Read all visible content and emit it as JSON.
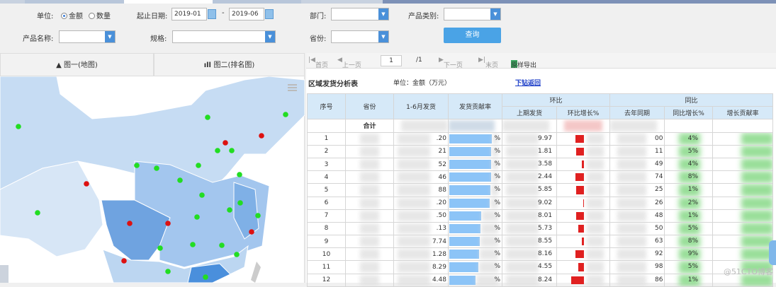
{
  "filters": {
    "unit_label": "单位:",
    "unit_options": [
      {
        "label": "金额",
        "selected": true
      },
      {
        "label": "数量",
        "selected": false
      }
    ],
    "date_label": "起止日期:",
    "date_start": "2019-01",
    "date_sep": "-",
    "date_end": "2019-06",
    "dept_label": "部门:",
    "category_label": "产品类别:",
    "product_label": "产品名称:",
    "spec_label": "规格:",
    "province_label": "省份:",
    "query_button": "查询"
  },
  "left_tabs": [
    {
      "label": "图一(地图)",
      "icon": "china-map-icon"
    },
    {
      "label": "图二(排名图)",
      "icon": "bar-chart-icon"
    }
  ],
  "map": {
    "colors": {
      "marker_up": "#22dd22",
      "marker_down": "#dd1111",
      "region": "#c6dcf3",
      "region_dark": "#6fa3e0"
    }
  },
  "pager": {
    "first": "首页",
    "prev": "上一页",
    "page": "1",
    "total": "/1",
    "next": "下一页",
    "last": "末页",
    "export": "原样导出"
  },
  "report": {
    "title": "区域发货分析表",
    "unit": "单位：金额（万元）",
    "drill_back": "下钻返回"
  },
  "table": {
    "headers": {
      "seq": "序号",
      "province": "省份",
      "ship": "1-6月发货",
      "contrib": "发货贡献率",
      "mom_group": "环比",
      "prev": "上期发货",
      "mom": "环比增长%",
      "yoy_group": "同比",
      "last_year": "去年同期",
      "yoy": "同比增长%",
      "growth_contrib": "增长贡献率"
    },
    "total_label": "合计",
    "rows": [
      {
        "seq": "1",
        "ship": ".20",
        "contrib": "%",
        "prev": "9.97",
        "last_year": "00",
        "yoy": "4%"
      },
      {
        "seq": "2",
        "ship": "21",
        "contrib": "%",
        "prev": "1.81",
        "last_year": "11",
        "yoy": "5%"
      },
      {
        "seq": "3",
        "ship": "52",
        "contrib": "%",
        "prev": "3.58",
        "last_year": "49",
        "yoy": "4%"
      },
      {
        "seq": "4",
        "ship": "46",
        "contrib": "%",
        "prev": "2.44",
        "last_year": "74",
        "yoy": "8%"
      },
      {
        "seq": "5",
        "ship": "88",
        "contrib": "%",
        "prev": "5.85",
        "last_year": "25",
        "yoy": "1%"
      },
      {
        "seq": "6",
        "ship": ".20",
        "contrib": "%",
        "prev": "9.02",
        "last_year": "26",
        "yoy": "2%"
      },
      {
        "seq": "7",
        "ship": ".50",
        "contrib": "%",
        "prev": "8.01",
        "last_year": "48",
        "yoy": "1%"
      },
      {
        "seq": "8",
        "ship": ".13",
        "contrib": "%",
        "prev": "5.73",
        "last_year": "50",
        "yoy": "5%"
      },
      {
        "seq": "9",
        "ship": "7.74",
        "contrib": "%",
        "prev": "8.55",
        "last_year": "63",
        "yoy": "8%"
      },
      {
        "seq": "10",
        "ship": "1.28",
        "contrib": "%",
        "prev": "8.16",
        "last_year": "92",
        "yoy": "9%"
      },
      {
        "seq": "11",
        "ship": "8.29",
        "contrib": "%",
        "prev": "4.55",
        "last_year": "98",
        "yoy": "5%"
      },
      {
        "seq": "12",
        "ship": "4.48",
        "contrib": "%",
        "prev": "8.24",
        "last_year": "86",
        "yoy": "1%"
      }
    ]
  },
  "watermark": "@51CTO博客"
}
